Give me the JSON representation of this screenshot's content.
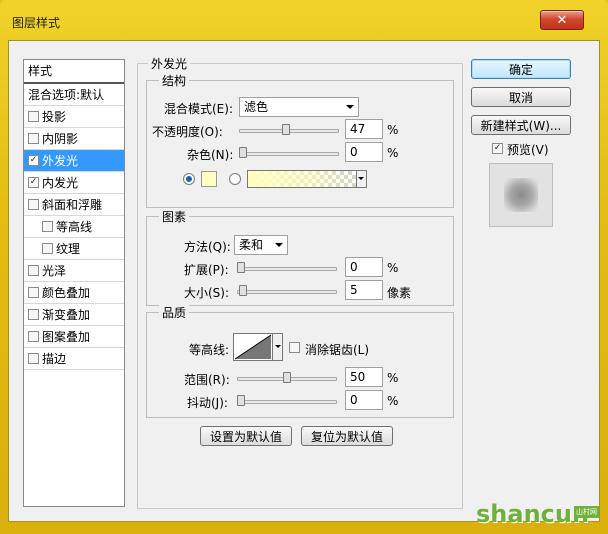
{
  "window": {
    "title": "图层样式",
    "close_label": "✕"
  },
  "style_list": {
    "header": "样式",
    "blend_default": "混合选项:默认",
    "items": [
      {
        "label": "投影",
        "checked": false,
        "sub": false,
        "selected": false
      },
      {
        "label": "内阴影",
        "checked": false,
        "sub": false,
        "selected": false
      },
      {
        "label": "外发光",
        "checked": true,
        "sub": false,
        "selected": true
      },
      {
        "label": "内发光",
        "checked": true,
        "sub": false,
        "selected": false
      },
      {
        "label": "斜面和浮雕",
        "checked": false,
        "sub": false,
        "selected": false
      },
      {
        "label": "等高线",
        "checked": false,
        "sub": true,
        "selected": false
      },
      {
        "label": "纹理",
        "checked": false,
        "sub": true,
        "selected": false
      },
      {
        "label": "光泽",
        "checked": false,
        "sub": false,
        "selected": false
      },
      {
        "label": "颜色叠加",
        "checked": false,
        "sub": false,
        "selected": false
      },
      {
        "label": "渐变叠加",
        "checked": false,
        "sub": false,
        "selected": false
      },
      {
        "label": "图案叠加",
        "checked": false,
        "sub": false,
        "selected": false
      },
      {
        "label": "描边",
        "checked": false,
        "sub": false,
        "selected": false
      }
    ]
  },
  "outer_glow": {
    "title": "外发光",
    "structure": {
      "title": "结构",
      "blend_mode_label": "混合模式(E):",
      "blend_mode_value": "滤色",
      "opacity_label": "不透明度(O):",
      "opacity_value": "47",
      "opacity_unit": "%",
      "noise_label": "杂色(N):",
      "noise_value": "0",
      "noise_unit": "%",
      "glow_color": "#ffffc0"
    },
    "elements": {
      "title": "图素",
      "technique_label": "方法(Q):",
      "technique_value": "柔和",
      "spread_label": "扩展(P):",
      "spread_value": "0",
      "spread_unit": "%",
      "size_label": "大小(S):",
      "size_value": "5",
      "size_unit": "像素"
    },
    "quality": {
      "title": "品质",
      "contour_label": "等高线:",
      "antialias_label": "消除锯齿(L)",
      "antialias_checked": false,
      "range_label": "范围(R):",
      "range_value": "50",
      "range_unit": "%",
      "jitter_label": "抖动(J):",
      "jitter_value": "0",
      "jitter_unit": "%"
    },
    "make_default_label": "设置为默认值",
    "reset_default_label": "复位为默认值"
  },
  "buttons": {
    "ok": "确定",
    "cancel": "取消",
    "new_style": "新建样式(W)...",
    "preview_label": "预览(V)",
    "preview_checked": true
  },
  "watermark": {
    "text": "shancun",
    "sub": "山村网"
  }
}
